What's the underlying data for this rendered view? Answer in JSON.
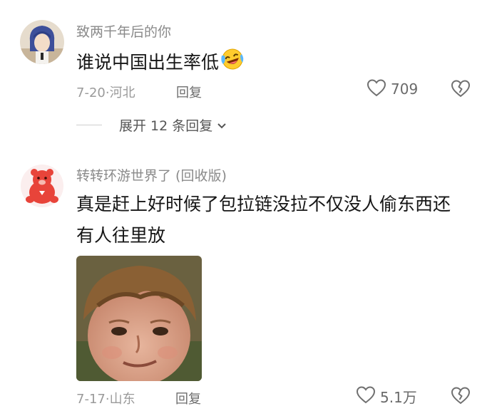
{
  "comments": [
    {
      "username": "致两千年后的你",
      "text": "谁说中国出生率低",
      "emoji": "laugh-cry-emoji",
      "date": "7-20",
      "location": "河北",
      "reply_label": "回复",
      "likes": "709",
      "expand_replies": "展开 12 条回复"
    },
    {
      "username": "转转环游世界了 (回收版)",
      "text_line1": "真是赶上好时候了包拉链没拉不仅没人偷东西还",
      "text_line2": "有人往里放",
      "date": "7-17",
      "location": "山东",
      "reply_label": "回复",
      "likes": "5.1万"
    }
  ],
  "colors": {
    "background": "#ffffff",
    "username": "#8a8a8a",
    "text": "#161616",
    "meta": "#9a9a9a",
    "icon": "#707070"
  },
  "icons": [
    "heart-icon",
    "broken-heart-icon",
    "chevron-down-icon"
  ]
}
